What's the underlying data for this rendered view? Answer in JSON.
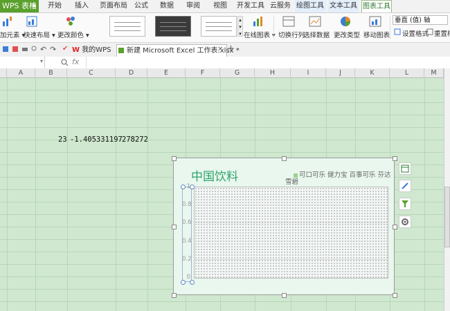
{
  "app": {
    "title": "WPS 表格"
  },
  "menu": [
    "开始",
    "插入",
    "页面布局",
    "公式",
    "数据",
    "审阅",
    "视图",
    "开发工具",
    "云服务",
    "绘图工具",
    "文本工具",
    "图表工具"
  ],
  "ribbon": {
    "add_element": "加元素",
    "quick_layout": "快速布局",
    "change_color": "更改颜色",
    "online_chart": "在线图表",
    "switch_row_col": "切换行列",
    "select_data": "选择数据",
    "change_type": "更改类型",
    "move_chart": "移动图表",
    "axis_selector": "垂直 (值) 轴",
    "set_format": "设置格式",
    "reset": "重置样"
  },
  "tabs": {
    "my_wps": "我的WPS",
    "file": "新建 Microsoft Excel 工作表.xlsx *"
  },
  "formula_bar": {
    "fx": "fx",
    "zoom": "Q"
  },
  "columns": [
    "A",
    "B",
    "C",
    "D",
    "E",
    "F",
    "G",
    "H",
    "I",
    "J",
    "K",
    "L",
    "M"
  ],
  "cells": {
    "b": "23",
    "c": "-1.405331197",
    "d": "278272"
  },
  "chart": {
    "title": "中国饮料",
    "legend_row1": "可口可乐 健力宝 百事可乐 芬达",
    "legend_row2": "雪碧",
    "y_ticks": [
      "1",
      "0.8",
      "0.6",
      "0.4",
      "0.2",
      "0"
    ]
  },
  "chart_data": {
    "type": "bar",
    "title": "中国饮料",
    "series": [
      {
        "name": "可口可乐",
        "values": []
      },
      {
        "name": "健力宝",
        "values": []
      },
      {
        "name": "百事可乐",
        "values": []
      },
      {
        "name": "芬达",
        "values": []
      },
      {
        "name": "雪碧",
        "values": []
      }
    ],
    "categories": [],
    "ylim": [
      0,
      1
    ],
    "y_ticks": [
      0,
      0.2,
      0.4,
      0.6,
      0.8,
      1
    ],
    "grid": true,
    "legend": "top-right"
  },
  "colors": {
    "accent_green": "#5aa02c",
    "title_green": "#2ea36b",
    "sheet_bg": "#cfe8cf"
  }
}
